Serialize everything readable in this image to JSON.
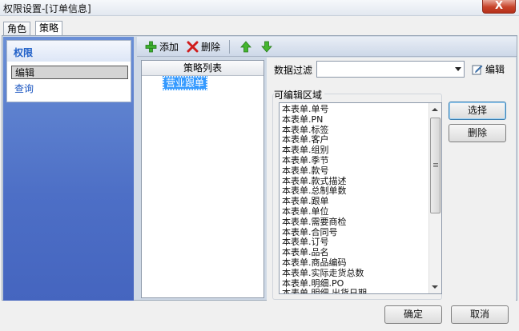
{
  "window": {
    "title": "权限设置-[订单信息]",
    "close_label": "X"
  },
  "tabs": [
    {
      "label": "角色",
      "active": false
    },
    {
      "label": "策略",
      "active": true
    }
  ],
  "permissions": {
    "header": "权限",
    "items": [
      {
        "label": "编辑",
        "selected": true
      },
      {
        "label": "查询",
        "selected": false
      }
    ]
  },
  "toolbar": {
    "add_label": "添加",
    "delete_label": "删除"
  },
  "policy_list": {
    "header": "策略列表",
    "items": [
      {
        "label": "营业跟单",
        "selected": true
      }
    ]
  },
  "data_filter": {
    "label": "数据过滤",
    "value": "",
    "edit_label": "编辑"
  },
  "editable_area": {
    "label": "可编辑区域",
    "fields": [
      "本表单.单号",
      "本表单.PN",
      "本表单.标签",
      "本表单.客户",
      "本表单.组别",
      "本表单.季节",
      "本表单.款号",
      "本表单.款式描述",
      "本表单.总制单数",
      "本表单.跟单",
      "本表单.单位",
      "本表单.需要商检",
      "本表单.合同号",
      "本表单.订号",
      "本表单.品名",
      "本表单.商品编码",
      "本表单.实际走货总数",
      "本表单.明细.PO",
      "本表单.明细.出货日期"
    ]
  },
  "side_buttons": {
    "select_label": "选择",
    "delete_label": "删除"
  },
  "footer": {
    "ok_label": "确定",
    "cancel_label": "取消"
  },
  "colors": {
    "accent": "#3399ff",
    "left_panel": "#4d6fc6",
    "close": "#c7432a"
  }
}
